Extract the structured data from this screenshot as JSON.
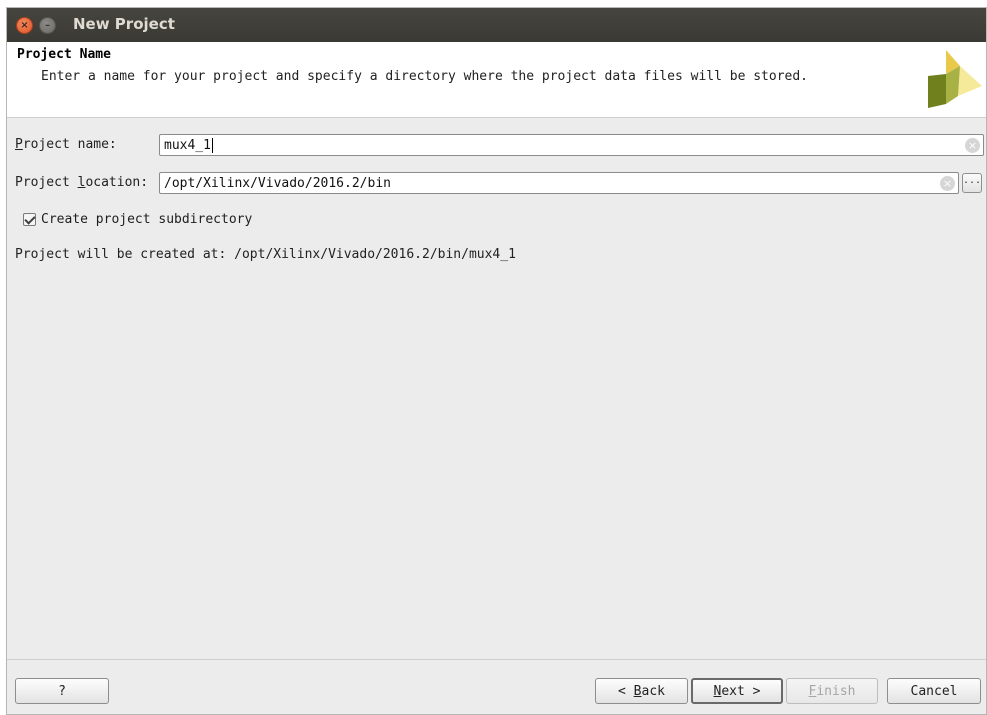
{
  "window": {
    "title": "New Project"
  },
  "header": {
    "title": "Project Name",
    "description": "Enter a name for your project and specify a directory where the project data files will be stored."
  },
  "form": {
    "project_name": {
      "label_prefix": "",
      "label_accel": "P",
      "label_rest": "roject name:",
      "value": "mux4_1"
    },
    "project_location": {
      "label_prefix": "Project ",
      "label_accel": "l",
      "label_rest": "ocation:",
      "value": "/opt/Xilinx/Vivado/2016.2/bin",
      "browse_label": "..."
    },
    "create_subdirectory": {
      "label": "Create project subdirectory",
      "checked": true
    },
    "created_at": "Project will be created at: /opt/Xilinx/Vivado/2016.2/bin/mux4_1"
  },
  "footer": {
    "help_label": "?",
    "back": {
      "prefix": "< ",
      "accel": "B",
      "rest": "ack"
    },
    "next": {
      "accel": "N",
      "rest": "ext >"
    },
    "finish": {
      "accel": "F",
      "rest": "inish"
    },
    "cancel_label": "Cancel"
  },
  "icons": {
    "close": "close-icon",
    "minimize": "minimize-icon",
    "logo": "vivado-logo",
    "clear": "clear-field-icon",
    "checkbox": "checkmark-icon"
  },
  "colors": {
    "titlebar": "#3c3b37",
    "logo_green_dark": "#6f7f1a",
    "logo_yellow": "#f2e47a"
  }
}
